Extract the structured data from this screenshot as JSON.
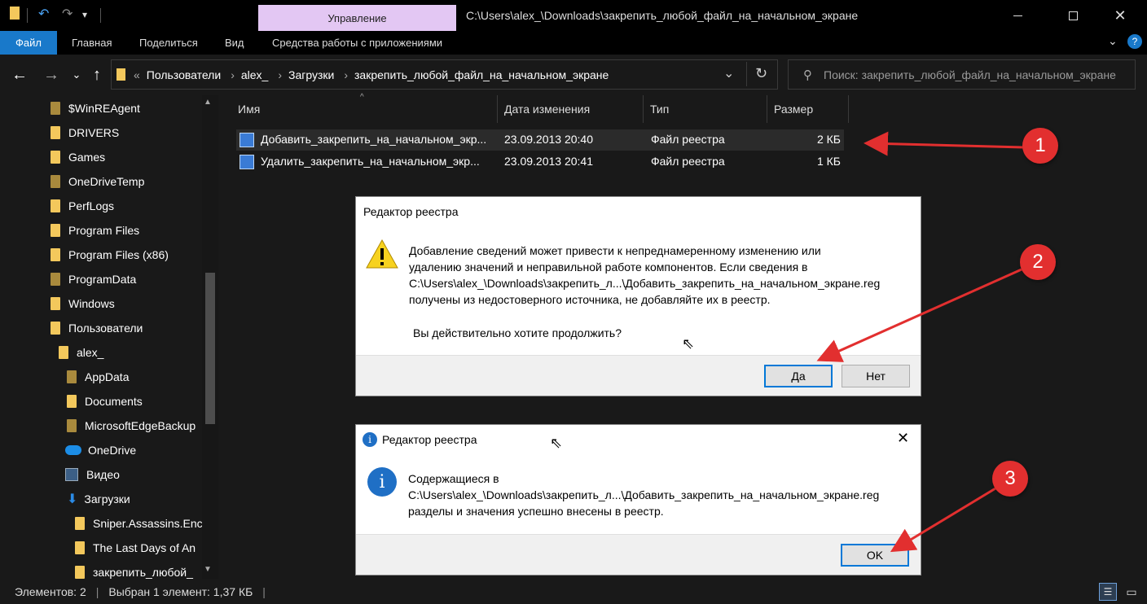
{
  "titlebar": {
    "context_tab": "Управление",
    "window_title": "C:\\Users\\alex_\\Downloads\\закрепить_любой_файл_на_начальном_экране"
  },
  "ribbon": {
    "tabs": [
      "Файл",
      "Главная",
      "Поделиться",
      "Вид",
      "Средства работы с приложениями"
    ]
  },
  "address": {
    "crumbs": [
      "Пользователи",
      "alex_",
      "Загрузки",
      "закрепить_любой_файл_на_начальном_экране"
    ]
  },
  "search": {
    "placeholder": "Поиск: закрепить_любой_файл_на_начальном_экране"
  },
  "sidebar": {
    "items": [
      {
        "label": "$WinREAgent",
        "icon": "folder-icon"
      },
      {
        "label": "DRIVERS",
        "icon": "folder-icon"
      },
      {
        "label": "Games",
        "icon": "folder-icon"
      },
      {
        "label": "OneDriveTemp",
        "icon": "folder-icon"
      },
      {
        "label": "PerfLogs",
        "icon": "folder-icon"
      },
      {
        "label": "Program Files",
        "icon": "folder-icon"
      },
      {
        "label": "Program Files (x86)",
        "icon": "folder-icon"
      },
      {
        "label": "ProgramData",
        "icon": "folder-icon"
      },
      {
        "label": "Windows",
        "icon": "folder-icon"
      },
      {
        "label": "Пользователи",
        "icon": "folder-icon"
      },
      {
        "label": "alex_",
        "icon": "folder-icon"
      },
      {
        "label": "AppData",
        "icon": "folder-icon"
      },
      {
        "label": "Documents",
        "icon": "folder-icon"
      },
      {
        "label": "MicrosoftEdgeBackup",
        "icon": "folder-icon"
      },
      {
        "label": "OneDrive",
        "icon": "onedrive-icon"
      },
      {
        "label": "Видео",
        "icon": "video-icon"
      },
      {
        "label": "Загрузки",
        "icon": "downloads-icon"
      },
      {
        "label": "Sniper.Assassins.Enc",
        "icon": "folder-icon"
      },
      {
        "label": "The Last Days of An",
        "icon": "folder-icon"
      },
      {
        "label": "закрепить_любой_",
        "icon": "folder-icon"
      }
    ]
  },
  "filelist": {
    "columns": [
      "Имя",
      "Дата изменения",
      "Тип",
      "Размер"
    ],
    "rows": [
      {
        "name": "Добавить_закрепить_на_начальном_экр...",
        "date": "23.09.2013 20:40",
        "type": "Файл реестра",
        "size": "2 КБ"
      },
      {
        "name": "Удалить_закрепить_на_начальном_экр...",
        "date": "23.09.2013 20:41",
        "type": "Файл реестра",
        "size": "1 КБ"
      }
    ]
  },
  "dialog_confirm": {
    "title": "Редактор реестра",
    "lines": [
      "Добавление сведений может привести к непреднамеренному изменению или",
      "удалению значений и неправильной работе компонентов. Если сведения в",
      "C:\\Users\\alex_\\Downloads\\закрепить_л...\\Добавить_закрепить_на_начальном_экране.reg",
      "получены из недостоверного источника, не добавляйте их в реестр."
    ],
    "question": "Вы действительно хотите продолжить?",
    "yes": "Да",
    "no": "Нет"
  },
  "dialog_info": {
    "title": "Редактор реестра",
    "lines": [
      "Содержащиеся в",
      "C:\\Users\\alex_\\Downloads\\закрепить_л...\\Добавить_закрепить_на_начальном_экране.reg",
      "разделы и значения успешно внесены в реестр."
    ],
    "ok": "OK"
  },
  "statusbar": {
    "count": "Элементов: 2",
    "selection": "Выбран 1 элемент: 1,37 КБ"
  },
  "callouts": [
    "1",
    "2",
    "3"
  ],
  "colors": {
    "accent": "#1979ca",
    "callout": "#e22f2f",
    "context_tab": "#e3c7f3"
  }
}
